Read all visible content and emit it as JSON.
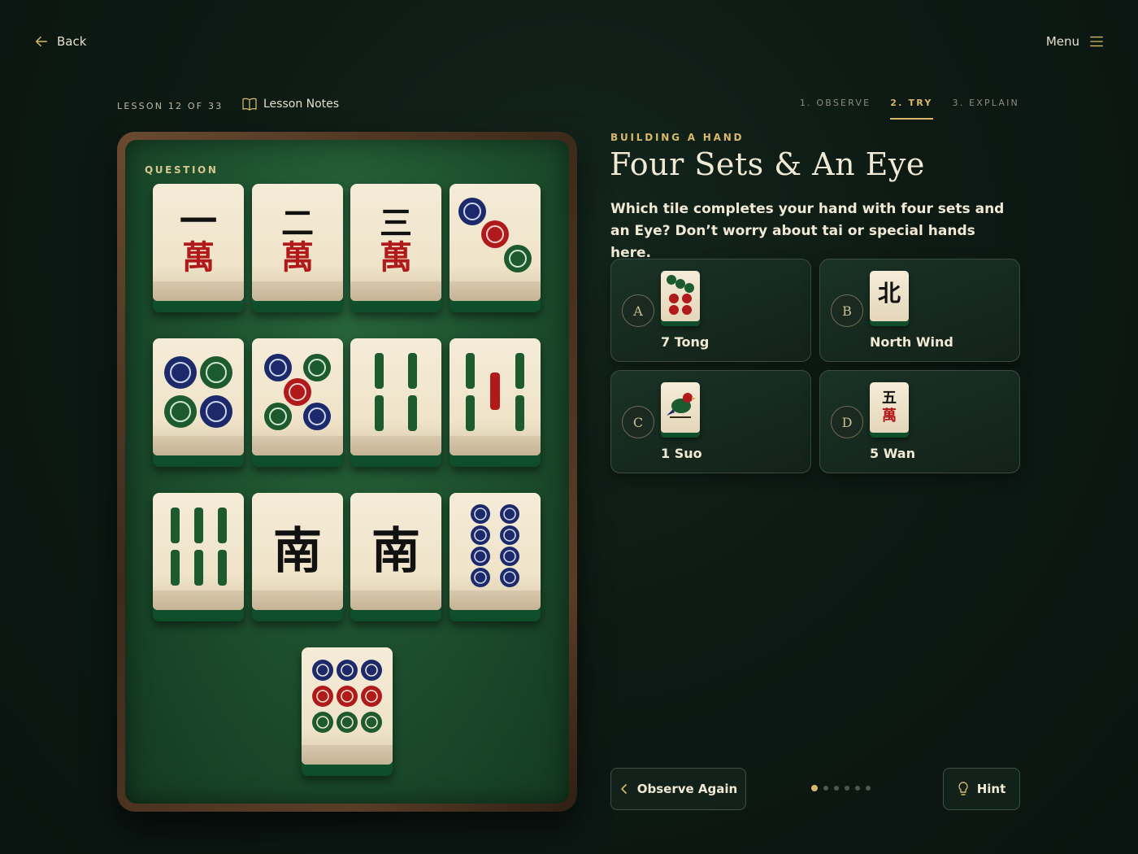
{
  "nav": {
    "back_label": "Back",
    "menu_label": "Menu"
  },
  "lesson": {
    "count_label": "LESSON 12 OF 33",
    "notes_label": "Lesson Notes"
  },
  "steps": [
    {
      "label": "1. OBSERVE",
      "active": false
    },
    {
      "label": "2. TRY",
      "active": true
    },
    {
      "label": "3. EXPLAIN",
      "active": false
    }
  ],
  "board": {
    "question_label": "QUESTION",
    "tiles": [
      "1 Wan",
      "2 Wan",
      "3 Wan",
      "3 Tong",
      "4 Tong",
      "5 Tong",
      "4 Suo",
      "5 Suo",
      "6 Suo",
      "South Wind",
      "South Wind",
      "8 Tong",
      "9 Tong"
    ]
  },
  "question": {
    "eyebrow": "BUILDING A HAND",
    "title": "Four Sets & An Eye",
    "prompt": "Which tile completes your hand with four sets and an Eye? Don’t worry about tai or special hands here."
  },
  "options": [
    {
      "letter": "A",
      "label": "7 Tong"
    },
    {
      "letter": "B",
      "label": "North Wind",
      "glyph": "北"
    },
    {
      "letter": "C",
      "label": "1 Suo"
    },
    {
      "letter": "D",
      "label": "5 Wan",
      "glyph_top": "五",
      "glyph_bottom": "萬"
    }
  ],
  "tile_glyphs": {
    "one": "一",
    "two": "二",
    "three": "三",
    "wan": "萬",
    "south": "南"
  },
  "footer": {
    "observe_again_label": "Observe Again",
    "hint_label": "Hint",
    "page_dots": 6,
    "active_dot": 0
  },
  "colors": {
    "accent": "#d9b86a",
    "felt": "#1c4d2c",
    "tile_face": "#f2e7d0",
    "red": "#b01a1a",
    "blue": "#1c2a6b",
    "green": "#1d5a2e"
  }
}
